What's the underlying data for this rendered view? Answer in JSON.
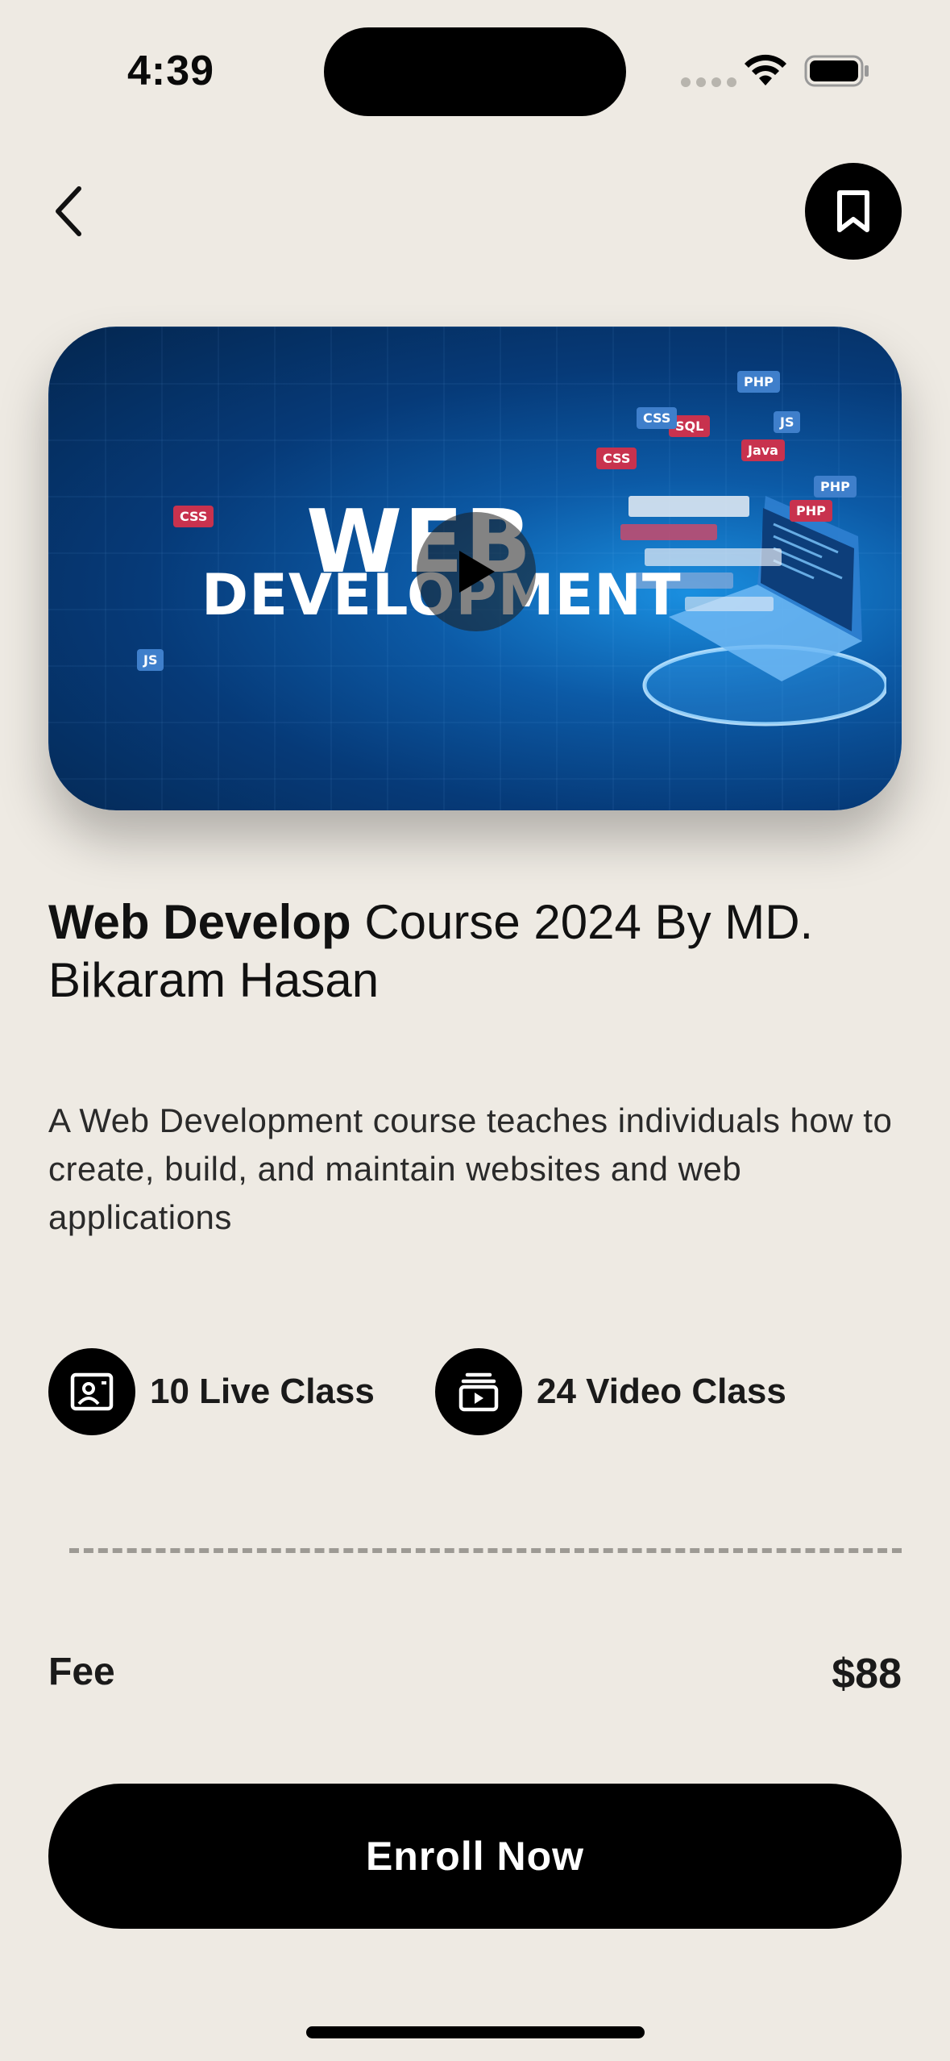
{
  "status_bar": {
    "time": "4:39"
  },
  "nav": {
    "back_icon": "chevron-left-icon",
    "bookmark_icon": "bookmark-icon"
  },
  "hero": {
    "title_line_1": "WEB",
    "title_line_2": "DEVELOPMENT",
    "play_icon": "play-icon",
    "tags": [
      "CSS",
      "PHP",
      "SQL",
      "Java",
      "PHP",
      "CSS",
      "PHP",
      "JS",
      "CSS",
      "JS"
    ]
  },
  "course": {
    "title_bold": "Web Develop",
    "title_rest": " Course 2024 By MD. Bikaram Hasan",
    "description": "A Web Development course teaches individuals how to create, build, and maintain websites and web applications"
  },
  "stats": [
    {
      "icon": "live-class-icon",
      "label": "10 Live Class"
    },
    {
      "icon": "video-class-icon",
      "label": "24 Video Class"
    }
  ],
  "fee": {
    "label": "Fee",
    "value": "$88"
  },
  "enroll_button": {
    "label": "Enroll Now"
  },
  "colors": {
    "background": "#EEEAE3",
    "primary": "#000000",
    "hero_blue": "#0c5aa6"
  }
}
